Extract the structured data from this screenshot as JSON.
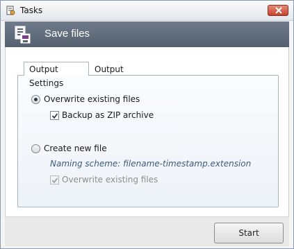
{
  "window": {
    "title": "Tasks"
  },
  "header": {
    "title": "Save files"
  },
  "tabs": [
    {
      "label": "Output Settings",
      "active": true
    },
    {
      "label": "Output",
      "active": false
    }
  ],
  "options": {
    "overwrite": {
      "label": "Overwrite existing files",
      "selected": true
    },
    "backup_zip": {
      "label": "Backup as ZIP archive",
      "checked": true
    },
    "create_new": {
      "label": "Create new file",
      "selected": false
    },
    "naming_scheme": "Naming scheme: filename-timestamp.extension",
    "overwrite_existing_disabled": {
      "label": "Overwrite existing files",
      "checked": true,
      "enabled": false
    }
  },
  "footer": {
    "start_label": "Start"
  },
  "icons": {
    "app": "tasks-app-icon",
    "close": "close-icon",
    "header": "save-files-icon"
  },
  "colors": {
    "header_bg": "#626e7d",
    "hint_text": "#3c5a7c",
    "close_button": "#c7432b"
  }
}
